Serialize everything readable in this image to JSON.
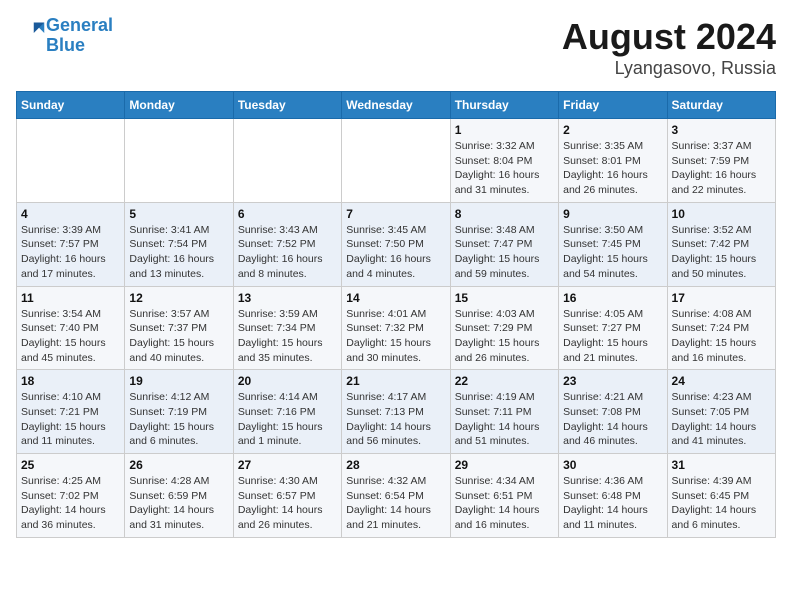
{
  "header": {
    "logo_line1": "General",
    "logo_line2": "Blue",
    "title": "August 2024",
    "subtitle": "Lyangasovo, Russia"
  },
  "weekdays": [
    "Sunday",
    "Monday",
    "Tuesday",
    "Wednesday",
    "Thursday",
    "Friday",
    "Saturday"
  ],
  "weeks": [
    [
      {
        "day": "",
        "info": ""
      },
      {
        "day": "",
        "info": ""
      },
      {
        "day": "",
        "info": ""
      },
      {
        "day": "",
        "info": ""
      },
      {
        "day": "1",
        "info": "Sunrise: 3:32 AM\nSunset: 8:04 PM\nDaylight: 16 hours\nand 31 minutes."
      },
      {
        "day": "2",
        "info": "Sunrise: 3:35 AM\nSunset: 8:01 PM\nDaylight: 16 hours\nand 26 minutes."
      },
      {
        "day": "3",
        "info": "Sunrise: 3:37 AM\nSunset: 7:59 PM\nDaylight: 16 hours\nand 22 minutes."
      }
    ],
    [
      {
        "day": "4",
        "info": "Sunrise: 3:39 AM\nSunset: 7:57 PM\nDaylight: 16 hours\nand 17 minutes."
      },
      {
        "day": "5",
        "info": "Sunrise: 3:41 AM\nSunset: 7:54 PM\nDaylight: 16 hours\nand 13 minutes."
      },
      {
        "day": "6",
        "info": "Sunrise: 3:43 AM\nSunset: 7:52 PM\nDaylight: 16 hours\nand 8 minutes."
      },
      {
        "day": "7",
        "info": "Sunrise: 3:45 AM\nSunset: 7:50 PM\nDaylight: 16 hours\nand 4 minutes."
      },
      {
        "day": "8",
        "info": "Sunrise: 3:48 AM\nSunset: 7:47 PM\nDaylight: 15 hours\nand 59 minutes."
      },
      {
        "day": "9",
        "info": "Sunrise: 3:50 AM\nSunset: 7:45 PM\nDaylight: 15 hours\nand 54 minutes."
      },
      {
        "day": "10",
        "info": "Sunrise: 3:52 AM\nSunset: 7:42 PM\nDaylight: 15 hours\nand 50 minutes."
      }
    ],
    [
      {
        "day": "11",
        "info": "Sunrise: 3:54 AM\nSunset: 7:40 PM\nDaylight: 15 hours\nand 45 minutes."
      },
      {
        "day": "12",
        "info": "Sunrise: 3:57 AM\nSunset: 7:37 PM\nDaylight: 15 hours\nand 40 minutes."
      },
      {
        "day": "13",
        "info": "Sunrise: 3:59 AM\nSunset: 7:34 PM\nDaylight: 15 hours\nand 35 minutes."
      },
      {
        "day": "14",
        "info": "Sunrise: 4:01 AM\nSunset: 7:32 PM\nDaylight: 15 hours\nand 30 minutes."
      },
      {
        "day": "15",
        "info": "Sunrise: 4:03 AM\nSunset: 7:29 PM\nDaylight: 15 hours\nand 26 minutes."
      },
      {
        "day": "16",
        "info": "Sunrise: 4:05 AM\nSunset: 7:27 PM\nDaylight: 15 hours\nand 21 minutes."
      },
      {
        "day": "17",
        "info": "Sunrise: 4:08 AM\nSunset: 7:24 PM\nDaylight: 15 hours\nand 16 minutes."
      }
    ],
    [
      {
        "day": "18",
        "info": "Sunrise: 4:10 AM\nSunset: 7:21 PM\nDaylight: 15 hours\nand 11 minutes."
      },
      {
        "day": "19",
        "info": "Sunrise: 4:12 AM\nSunset: 7:19 PM\nDaylight: 15 hours\nand 6 minutes."
      },
      {
        "day": "20",
        "info": "Sunrise: 4:14 AM\nSunset: 7:16 PM\nDaylight: 15 hours\nand 1 minute."
      },
      {
        "day": "21",
        "info": "Sunrise: 4:17 AM\nSunset: 7:13 PM\nDaylight: 14 hours\nand 56 minutes."
      },
      {
        "day": "22",
        "info": "Sunrise: 4:19 AM\nSunset: 7:11 PM\nDaylight: 14 hours\nand 51 minutes."
      },
      {
        "day": "23",
        "info": "Sunrise: 4:21 AM\nSunset: 7:08 PM\nDaylight: 14 hours\nand 46 minutes."
      },
      {
        "day": "24",
        "info": "Sunrise: 4:23 AM\nSunset: 7:05 PM\nDaylight: 14 hours\nand 41 minutes."
      }
    ],
    [
      {
        "day": "25",
        "info": "Sunrise: 4:25 AM\nSunset: 7:02 PM\nDaylight: 14 hours\nand 36 minutes."
      },
      {
        "day": "26",
        "info": "Sunrise: 4:28 AM\nSunset: 6:59 PM\nDaylight: 14 hours\nand 31 minutes."
      },
      {
        "day": "27",
        "info": "Sunrise: 4:30 AM\nSunset: 6:57 PM\nDaylight: 14 hours\nand 26 minutes."
      },
      {
        "day": "28",
        "info": "Sunrise: 4:32 AM\nSunset: 6:54 PM\nDaylight: 14 hours\nand 21 minutes."
      },
      {
        "day": "29",
        "info": "Sunrise: 4:34 AM\nSunset: 6:51 PM\nDaylight: 14 hours\nand 16 minutes."
      },
      {
        "day": "30",
        "info": "Sunrise: 4:36 AM\nSunset: 6:48 PM\nDaylight: 14 hours\nand 11 minutes."
      },
      {
        "day": "31",
        "info": "Sunrise: 4:39 AM\nSunset: 6:45 PM\nDaylight: 14 hours\nand 6 minutes."
      }
    ]
  ]
}
